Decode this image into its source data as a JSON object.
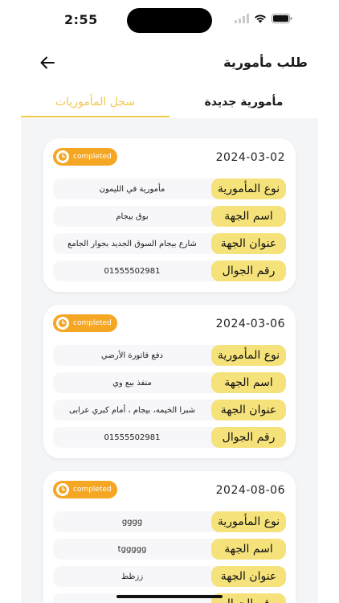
{
  "status": {
    "time": "2:55"
  },
  "header": {
    "title": "طلب مأمورية",
    "back_icon": "arrow-left-icon"
  },
  "tabs": {
    "new": "مأمورية جديدة",
    "history": "سجل المأموريات"
  },
  "labels": {
    "type": "نوع المأمورية",
    "entity": "اسم الجهة",
    "address": "عنوان الجهة",
    "phone": "رقم الجوال"
  },
  "colors": {
    "accent": "#f2c94c",
    "badge": "#f5a623",
    "label_bg": "#f6e27a"
  },
  "cards": [
    {
      "date": "2024-03-02",
      "status": "completed",
      "type": "مأمورية في الليمون",
      "entity": "بوق بيجام",
      "address": "شارع بيجام السوق الجديد بجوار الجامع",
      "phone": "01555502981"
    },
    {
      "date": "2024-03-06",
      "status": "completed",
      "type": "دفع فاتورة الأرضي",
      "entity": "منفذ بيع وي",
      "address": "شبرا الخيمه، بيجام ، أمام كبري عرابى",
      "phone": "01555502981"
    },
    {
      "date": "2024-08-06",
      "status": "completed",
      "type": "gggg",
      "entity": "tggggg",
      "address": "ززظط",
      "phone": ""
    }
  ]
}
